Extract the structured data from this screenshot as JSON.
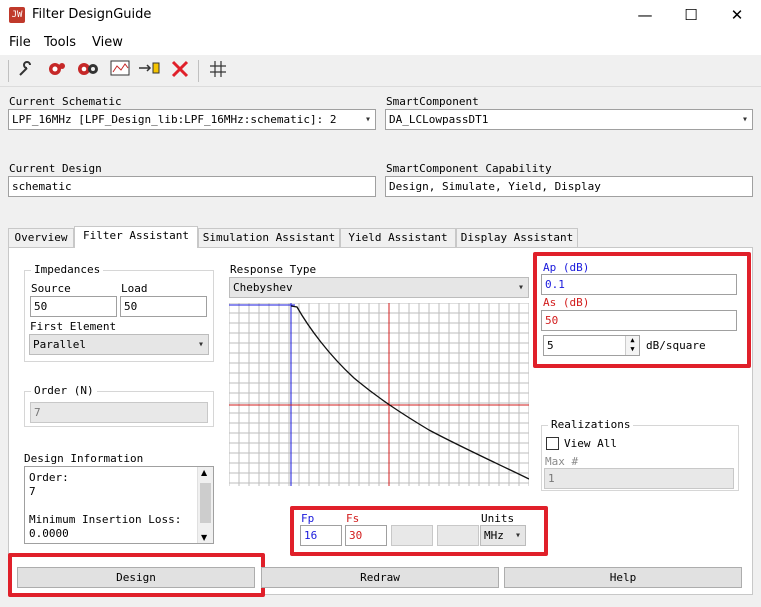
{
  "window": {
    "title": "Filter DesignGuide",
    "icon_text": "JW",
    "minimize": "—",
    "maximize": "☐",
    "close": "✕"
  },
  "menu": {
    "file": "File",
    "tools": "Tools",
    "view": "View"
  },
  "toolbar": {
    "icons": [
      "wrench-icon",
      "gear-red-icon",
      "gears-icon",
      "chart-icon",
      "move-icon",
      "delete-icon",
      "grid-icon"
    ]
  },
  "header": {
    "current_schematic_label": "Current Schematic",
    "current_schematic_value": "LPF_16MHz [LPF_Design_lib:LPF_16MHz:schematic]: 2",
    "smart_component_label": "SmartComponent",
    "smart_component_value": "DA_LCLowpassDT1",
    "current_design_label": "Current Design",
    "current_design_value": "schematic",
    "capability_label": "SmartComponent Capability",
    "capability_value": "Design, Simulate, Yield, Display"
  },
  "tabs": [
    "Overview",
    "Filter Assistant",
    "Simulation Assistant",
    "Yield Assistant",
    "Display Assistant"
  ],
  "active_tab": "Filter Assistant",
  "impedances": {
    "title": "Impedances",
    "source_label": "Source",
    "source_value": "50",
    "load_label": "Load",
    "load_value": "50",
    "first_element_label": "First Element",
    "first_element_value": "Parallel"
  },
  "order": {
    "title": "Order (N)",
    "value": "7"
  },
  "design_info": {
    "title": "Design Information",
    "lines": [
      "Order:",
      "7",
      "",
      "Minimum Insertion Loss:",
      "0.0000"
    ]
  },
  "response": {
    "label": "Response Type",
    "value": "Chebyshev"
  },
  "spec": {
    "ap_label": "Ap (dB)",
    "ap_value": "0.1",
    "as_label": "As (dB)",
    "as_value": "50",
    "db_per_square_value": "5",
    "db_per_square_label": "dB/square"
  },
  "realizations": {
    "title": "Realizations",
    "view_all_label": "View All",
    "view_all_checked": false,
    "max_label": "Max #",
    "max_value": "1"
  },
  "freq": {
    "fp_label": "Fp",
    "fp_value": "16",
    "fs_label": "Fs",
    "fs_value": "30",
    "units_label": "Units",
    "units_value": "MHz"
  },
  "buttons": {
    "design": "Design",
    "redraw": "Redraw",
    "help": "Help"
  },
  "colors": {
    "highlight": "#e0202a",
    "fp": "#1a1adc",
    "fs": "#d21c1c"
  }
}
